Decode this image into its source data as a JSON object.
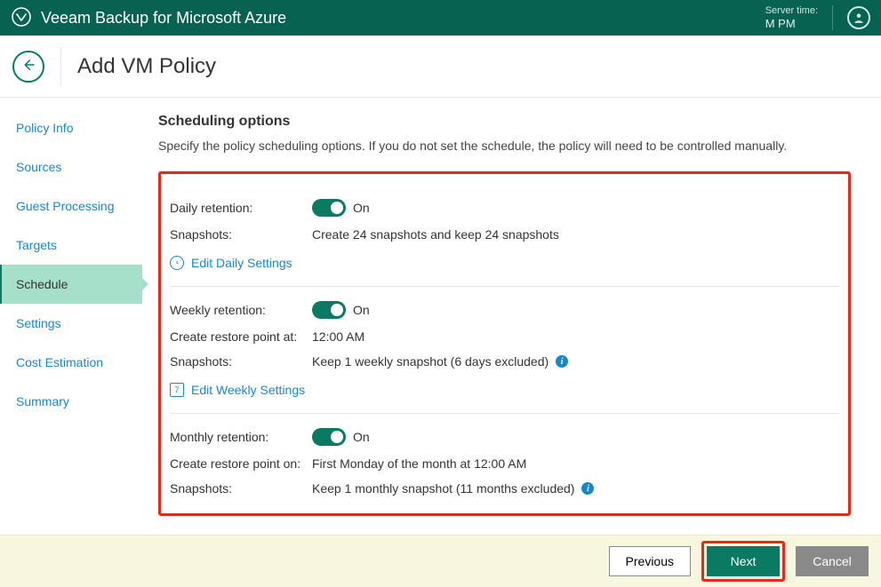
{
  "topbar": {
    "product": "Veeam Backup for Microsoft Azure",
    "server_time_label": "Server time:",
    "server_time_value": "M                                PM"
  },
  "header": {
    "title": "Add VM Policy"
  },
  "sidebar": {
    "items": [
      {
        "label": "Policy Info"
      },
      {
        "label": "Sources"
      },
      {
        "label": "Guest Processing"
      },
      {
        "label": "Targets"
      },
      {
        "label": "Schedule"
      },
      {
        "label": "Settings"
      },
      {
        "label": "Cost Estimation"
      },
      {
        "label": "Summary"
      }
    ]
  },
  "main": {
    "title": "Scheduling options",
    "description": "Specify the policy scheduling options. If you do not set the schedule, the policy will need to be controlled manually.",
    "daily": {
      "label": "Daily retention:",
      "state": "On",
      "snapshots_label": "Snapshots:",
      "snapshots_value": "Create 24 snapshots and keep 24 snapshots",
      "edit": "Edit Daily Settings"
    },
    "weekly": {
      "label": "Weekly retention:",
      "state": "On",
      "create_label": "Create restore point at:",
      "create_value": "12:00 AM",
      "snapshots_label": "Snapshots:",
      "snapshots_value": "Keep 1 weekly snapshot (6 days excluded)",
      "edit": "Edit Weekly Settings"
    },
    "monthly": {
      "label": "Monthly retention:",
      "state": "On",
      "create_label": "Create restore point on:",
      "create_value": "First Monday of the month at 12:00 AM",
      "snapshots_label": "Snapshots:",
      "snapshots_value": "Keep 1 monthly snapshot (11 months excluded)"
    }
  },
  "footer": {
    "previous": "Previous",
    "next": "Next",
    "cancel": "Cancel"
  }
}
